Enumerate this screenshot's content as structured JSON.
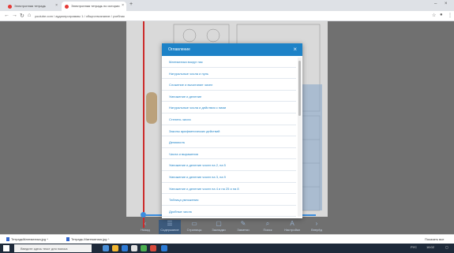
{
  "browser": {
    "tabs": [
      {
        "title": "Электронная тетрадь",
        "active": false
      },
      {
        "title": "Электронная тетрадь по истории",
        "active": true
      }
    ],
    "new_tab": "+",
    "url": "youtube.com / аудиопрограммы 1 / обществознание / учебник",
    "window_controls": [
      "–",
      "×"
    ]
  },
  "modal": {
    "title": "Оглавление",
    "close": "×",
    "items": [
      "Математика вокруг нас",
      "Натуральные числа и нуль",
      "Сложение и вычитание чисел",
      "Умножение и деление",
      "Натуральные числа и действия с ними",
      "Степень числа",
      "Законы арифметических действий",
      "Делимость",
      "Числа и выражения",
      "Умножение и деление чисел на 2, на 5",
      "Умножение и деление чисел на 3, на 9",
      "Умножение и деление чисел на 4 и на 25 и на 8",
      "Таблица умножения",
      "Дробные числа"
    ]
  },
  "toolbar": {
    "items": [
      {
        "icon": "‹",
        "label": "Назад"
      },
      {
        "icon": "☰",
        "label": "Содержание"
      },
      {
        "icon": "▭",
        "label": "Страницы"
      },
      {
        "icon": "▢",
        "label": "Закладки"
      },
      {
        "icon": "✎",
        "label": "Заметки"
      },
      {
        "icon": "⌕",
        "label": "Поиск"
      },
      {
        "icon": "A",
        "label": "Настройки"
      },
      {
        "icon": "›",
        "label": "Вперёд"
      }
    ]
  },
  "downloads": {
    "items": [
      "ТетрадьМатематика.jpg",
      "Тетрадь-Математика.jpg"
    ],
    "show_all": "Показать все"
  },
  "taskbar": {
    "search_placeholder": "Введите здесь текст для поиска",
    "time": "16:02",
    "lang": "РУС"
  },
  "colors": {
    "accent": "#1d82c7",
    "toolbar_active": "#3c5a7c",
    "red_line": "#cc2b2b"
  }
}
